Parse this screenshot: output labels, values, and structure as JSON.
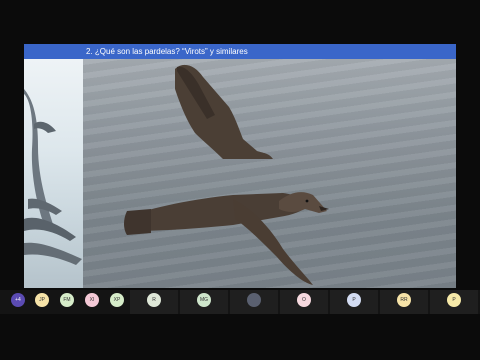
{
  "slide": {
    "title": "2. ¿Qué son las pardelas? “Virots” y similares"
  },
  "toolbar": {
    "more_count": "+4",
    "small_avatars": [
      {
        "initials": "JP",
        "color": "#f6e3a8"
      },
      {
        "initials": "FM",
        "color": "#d6ecc9"
      },
      {
        "initials": "XI",
        "color": "#f4c9d6"
      },
      {
        "initials": "XP",
        "color": "#d6ecc9"
      }
    ],
    "tiles": [
      {
        "initials": "R",
        "color": "#dfe8d8"
      },
      {
        "initials": "MG",
        "color": "#cfe6cc"
      },
      {
        "initials": "",
        "color": "#5a6070"
      },
      {
        "initials": "O",
        "color": "#f6d9df"
      },
      {
        "initials": "P",
        "color": "#d3dcf2"
      },
      {
        "initials": "RR",
        "color": "#f6e3a8"
      },
      {
        "initials": "P",
        "color": "#f6e9a8"
      }
    ]
  }
}
